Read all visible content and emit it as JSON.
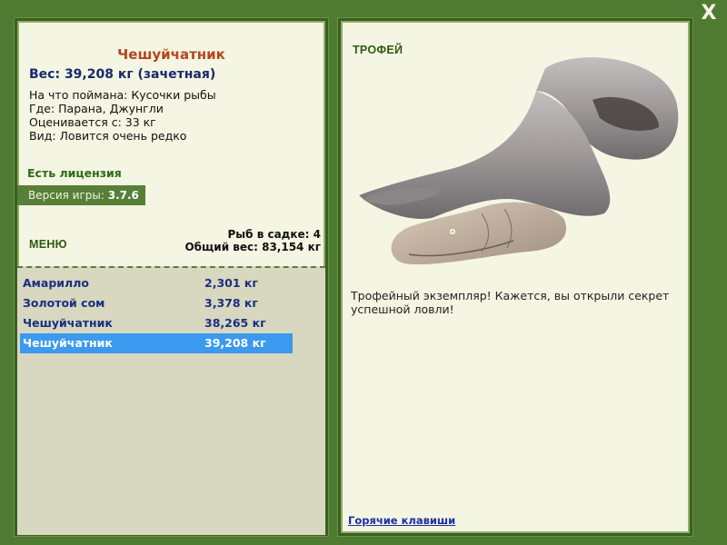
{
  "fish": {
    "name": "Чешуйчатник",
    "weight_line": "Вес: 39,208 кг (зачетная)",
    "bait": "На что поймана: Кусочки рыбы",
    "place": "Где: Парана, Джунгли",
    "value": "Оценивается с: 33 кг",
    "kind": "Вид: Ловится очень редко"
  },
  "license": "Есть лицензия",
  "version": {
    "label": "Версия игры: ",
    "value": "3.7.6"
  },
  "menu_label": "МЕНЮ",
  "cage": {
    "count": "Рыб в садке: 4",
    "total": "Общий вес: 83,154 кг"
  },
  "catches": [
    {
      "name": "Амарилло",
      "weight": "2,301 кг"
    },
    {
      "name": "Золотой сом",
      "weight": "3,378 кг"
    },
    {
      "name": "Чешуйчатник",
      "weight": "38,265 кг"
    },
    {
      "name": "Чешуйчатник",
      "weight": "39,208 кг"
    }
  ],
  "selected_catch": 3,
  "trophy": {
    "label": "ТРОФЕЙ",
    "text": "Трофейный экземпляр! Кажется, вы открыли секрет успешной ловли!"
  },
  "hotkeys": "Горячие клавиши",
  "close_glyph": "X",
  "colors": {
    "background": "#4e7a31",
    "selected_row": "#3b9aef",
    "title": "#b5461a"
  }
}
